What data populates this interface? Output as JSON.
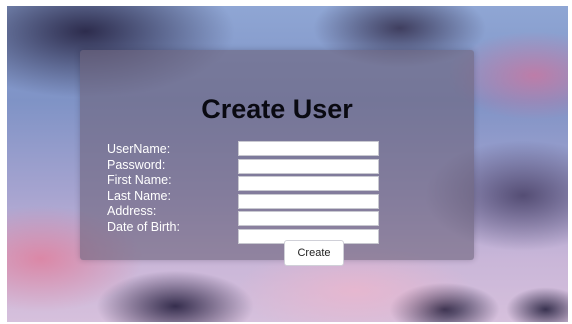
{
  "form": {
    "title": "Create User",
    "fields": [
      {
        "label": "UserName:",
        "value": "",
        "placeholder": ""
      },
      {
        "label": "Password:",
        "value": "",
        "placeholder": ""
      },
      {
        "label": "First Name:",
        "value": "",
        "placeholder": ""
      },
      {
        "label": "Last Name:",
        "value": "",
        "placeholder": ""
      },
      {
        "label": "Address:",
        "value": "",
        "placeholder": ""
      },
      {
        "label": "Date of Birth:",
        "value": "",
        "placeholder": ""
      }
    ],
    "submit_label": "Create"
  }
}
